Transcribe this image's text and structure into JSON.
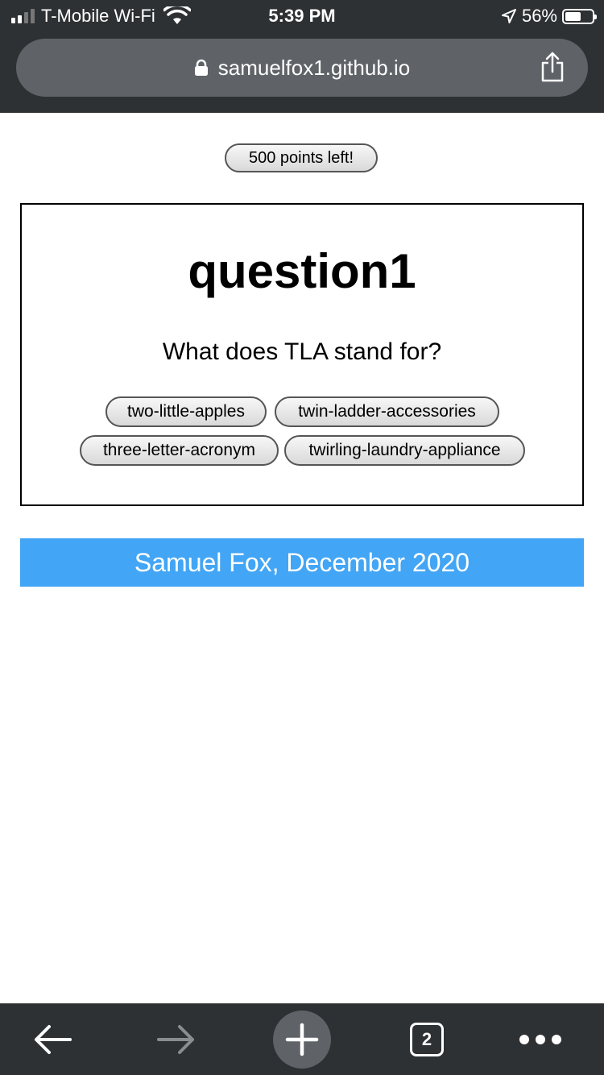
{
  "status_bar": {
    "carrier": "T-Mobile Wi-Fi",
    "time": "5:39 PM",
    "battery": "56%",
    "battery_level": 0.56,
    "signal_bars": 2
  },
  "browser": {
    "url": "samuelfox1.github.io",
    "tab_count": "2"
  },
  "page": {
    "points": "500 points left!",
    "question_title": "question1",
    "question_text": "What does TLA stand for?",
    "answers": [
      "two-little-apples",
      "twin-ladder-accessories",
      "three-letter-acronym",
      "twirling-laundry-appliance"
    ],
    "footer": "Samuel Fox, December 2020"
  },
  "colors": {
    "chrome": "#2e3134",
    "url_bar": "#5f6367",
    "footer_banner": "#42a5f5"
  },
  "icons": {
    "wifi": "wifi-icon",
    "location": "location-arrow-icon",
    "lock": "lock-icon",
    "share": "share-icon",
    "back": "back-arrow-icon",
    "forward": "forward-arrow-icon",
    "new_tab": "plus-icon",
    "more": "more-dots-icon"
  }
}
